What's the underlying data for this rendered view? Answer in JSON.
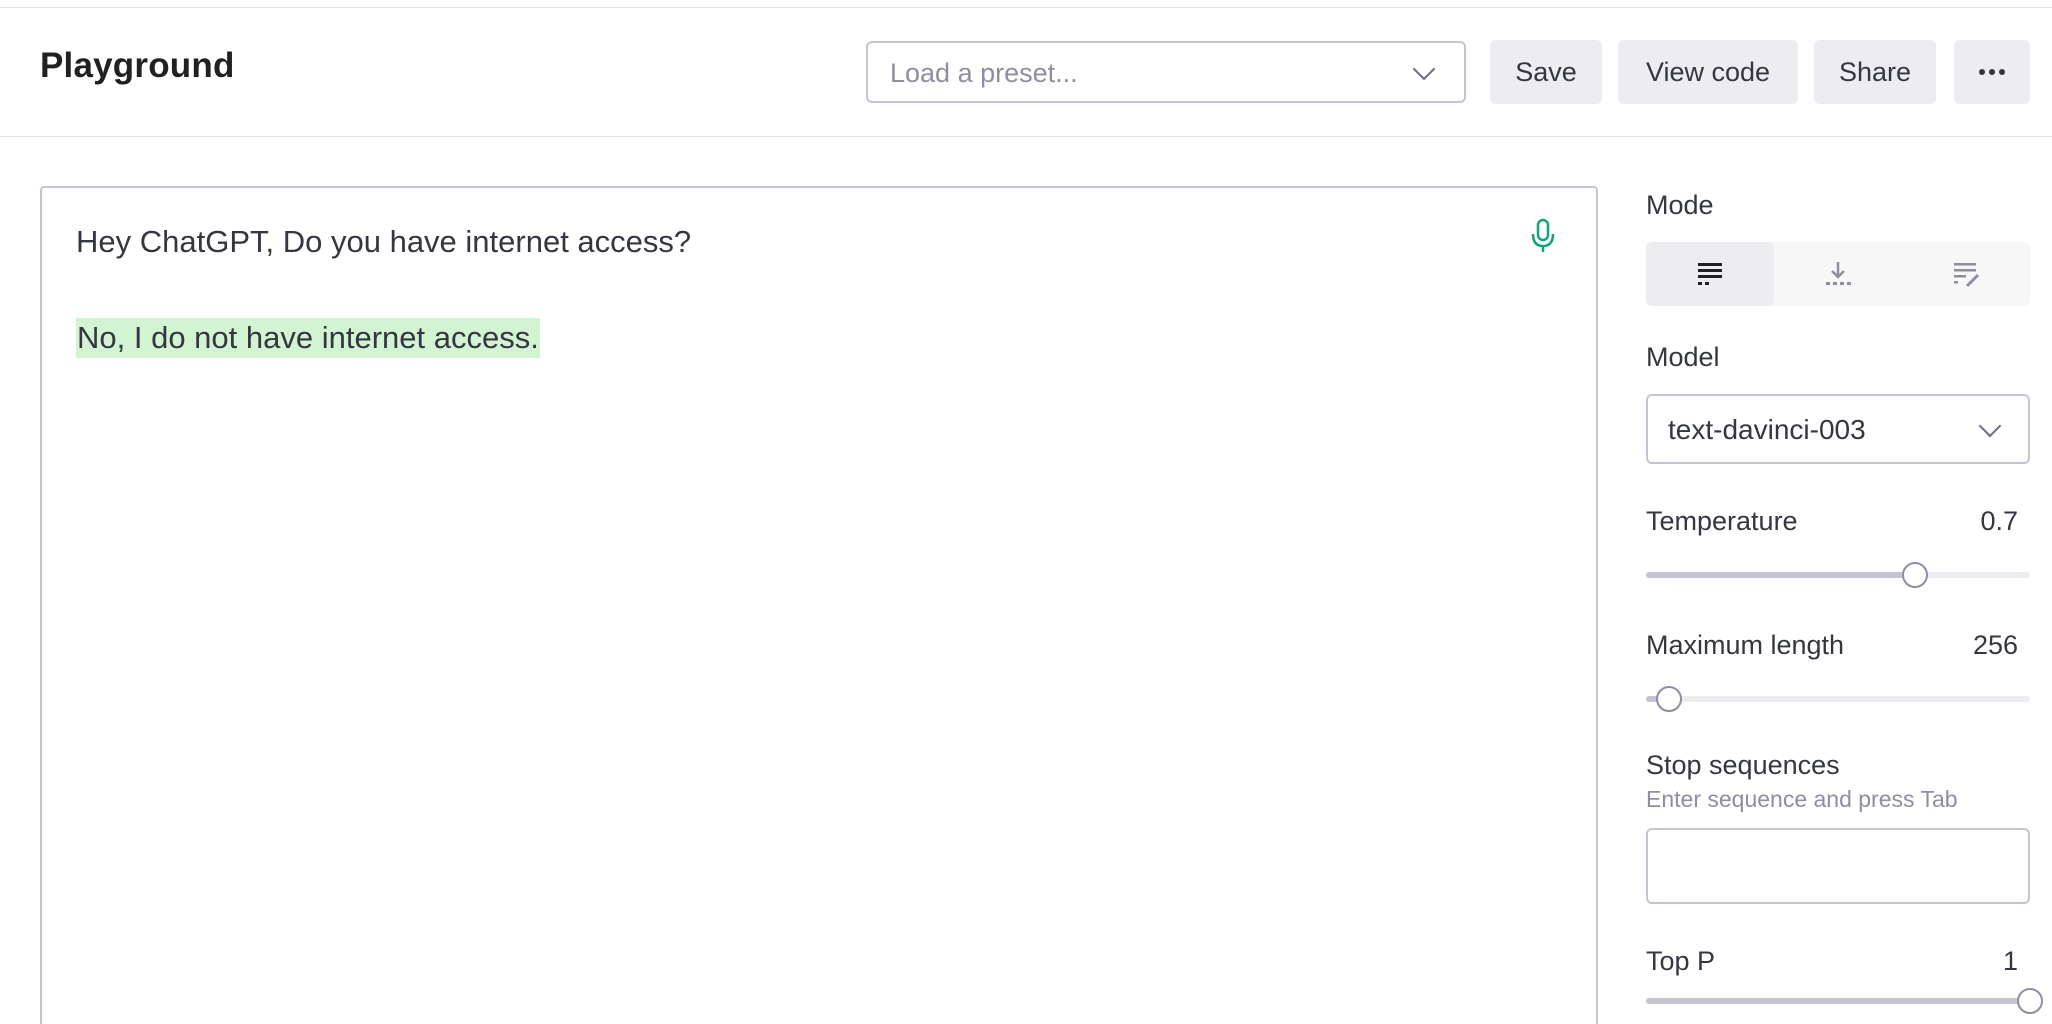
{
  "header": {
    "title": "Playground",
    "preset_placeholder": "Load a preset...",
    "save_label": "Save",
    "view_code_label": "View code",
    "share_label": "Share",
    "more_icon": "more-horizontal-icon"
  },
  "editor": {
    "prompt": "Hey ChatGPT, Do you have internet access?",
    "completion": "No, I do not have internet access.",
    "completion_highlight": "#d2f4d3",
    "mic_icon": "microphone-icon",
    "mic_color": "#10a37f"
  },
  "settings": {
    "mode": {
      "label": "Mode",
      "options": [
        "complete-icon",
        "insert-icon",
        "edit-icon"
      ],
      "selected_index": 0
    },
    "model": {
      "label": "Model",
      "value": "text-davinci-003"
    },
    "temperature": {
      "label": "Temperature",
      "value": "0.7",
      "fraction": 0.7
    },
    "max_length": {
      "label": "Maximum length",
      "value": "256",
      "fraction": 0.06
    },
    "stop_sequences": {
      "label": "Stop sequences",
      "hint": "Enter sequence and press Tab",
      "value": ""
    },
    "top_p": {
      "label": "Top P",
      "value": "1",
      "fraction": 1.0
    }
  }
}
